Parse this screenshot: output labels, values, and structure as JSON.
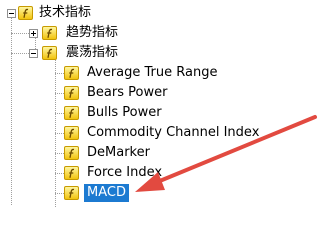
{
  "tree": {
    "root": {
      "label": "技术指标",
      "expanded": true
    },
    "groups": [
      {
        "label": "趋势指标",
        "expanded": false
      },
      {
        "label": "震荡指标",
        "expanded": true,
        "items": [
          {
            "label": "Average True Range",
            "selected": false
          },
          {
            "label": "Bears Power",
            "selected": false
          },
          {
            "label": "Bulls Power",
            "selected": false
          },
          {
            "label": "Commodity Channel Index",
            "selected": false
          },
          {
            "label": "DeMarker",
            "selected": false
          },
          {
            "label": "Force Index",
            "selected": false
          },
          {
            "label": "MACD",
            "selected": true
          }
        ]
      }
    ]
  },
  "colors": {
    "selection": "#1c7ad1",
    "annotation_arrow": "#e24a40",
    "icon": "#f2c40e"
  },
  "icon_name": "indicator-f-icon"
}
